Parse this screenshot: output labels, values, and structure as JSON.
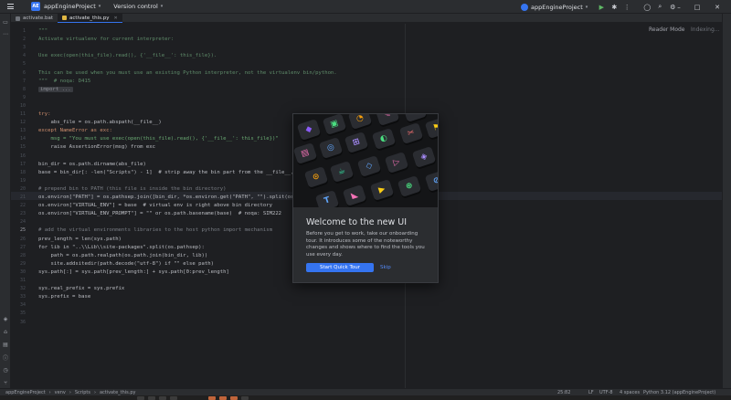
{
  "titlebar": {
    "project_badge": "AE",
    "project_name": "appEngineProject",
    "version_control": "Version control",
    "run_config": "appEngineProject"
  },
  "tabs": [
    {
      "label": "activate.bat"
    },
    {
      "label": "activate_this.py"
    }
  ],
  "editor": {
    "reader_mode": "Reader Mode",
    "indexing": "Indexing...",
    "line_numbers": [
      "1",
      "2",
      "3",
      "4",
      "5",
      "6",
      "7",
      "8",
      "9",
      "10",
      "11",
      "12",
      "13",
      "14",
      "15",
      "16",
      "17",
      "18",
      "19",
      "20",
      "21",
      "22",
      "23",
      "24",
      "25",
      "26",
      "27",
      "28",
      "29",
      "30",
      "31",
      "32",
      "33",
      "34",
      "35",
      "36"
    ],
    "current_line": "25",
    "code": [
      {
        "text": "\"\"\"",
        "cls": "doc"
      },
      {
        "text": "Activate virtualenv for current interpreter:",
        "cls": "doc"
      },
      {
        "text": "",
        "cls": ""
      },
      {
        "text": "Use exec(open(this_file).read(), {'__file__': this_file}).",
        "cls": "doc"
      },
      {
        "text": "",
        "cls": ""
      },
      {
        "text": "This can be used when you must use an existing Python interpreter, not the virtualenv bin/python.",
        "cls": "doc"
      },
      {
        "text": "\"\"\"  # noqa: D415",
        "cls": "doc"
      },
      {
        "text": "import ...",
        "cls": "fold"
      },
      {
        "text": "",
        "cls": ""
      },
      {
        "text": "",
        "cls": ""
      },
      {
        "text": "try:",
        "cls": "kw"
      },
      {
        "text": "    abs_file = os.path.abspath(__file__)",
        "cls": ""
      },
      {
        "text": "except NameError as exc:",
        "cls": "kw"
      },
      {
        "text": "    msg = \"You must use exec(open(this_file).read(), {'__file__': this_file})\"",
        "cls": "str"
      },
      {
        "text": "    raise AssertionError(msg) from exc",
        "cls": ""
      },
      {
        "text": "",
        "cls": ""
      },
      {
        "text": "bin_dir = os.path.dirname(abs_file)",
        "cls": ""
      },
      {
        "text": "base = bin_dir[: -len(\"Scripts\") - 1]  # strip away the bin part from the __file__, plus the path separator",
        "cls": ""
      },
      {
        "text": "",
        "cls": ""
      },
      {
        "text": "# prepend bin to PATH (this file is inside the bin directory)",
        "cls": "cmt"
      },
      {
        "text": "os.environ[\"PATH\"] = os.pathsep.join([bin_dir, *os.environ.get(\"PATH\", \"\").split(os.pathsep)])",
        "cls": ""
      },
      {
        "text": "os.environ[\"VIRTUAL_ENV\"] = base  # virtual env is right above bin directory",
        "cls": ""
      },
      {
        "text": "os.environ[\"VIRTUAL_ENV_PROMPT\"] = \"\" or os.path.basename(base)  # noqa: SIM222",
        "cls": ""
      },
      {
        "text": "",
        "cls": ""
      },
      {
        "text": "# add the virtual environments libraries to the host python import mechanism",
        "cls": "cmt"
      },
      {
        "text": "prev_length = len(sys.path)",
        "cls": ""
      },
      {
        "text": "for lib in \"..\\\\Lib\\\\site-packages\".split(os.pathsep):",
        "cls": ""
      },
      {
        "text": "    path = os.path.realpath(os.path.join(bin_dir, lib))",
        "cls": ""
      },
      {
        "text": "    site.addsitedir(path.decode(\"utf-8\") if \"\" else path)",
        "cls": ""
      },
      {
        "text": "sys.path[:] = sys.path[prev_length:] + sys.path[0:prev_length]",
        "cls": ""
      },
      {
        "text": "",
        "cls": ""
      },
      {
        "text": "sys.real_prefix = sys.prefix",
        "cls": ""
      },
      {
        "text": "sys.prefix = base",
        "cls": ""
      },
      {
        "text": "",
        "cls": ""
      }
    ]
  },
  "popup": {
    "title": "Welcome to the new UI",
    "body": "Before you get to work, take our onboarding tour. It introduces some of the noteworthy changes and shows where to find the tools you use every day.",
    "primary_button": "Start Quick Tour",
    "skip_button": "Skip"
  },
  "statusbar": {
    "breadcrumbs": [
      "appEngineProject",
      "venv",
      "Scripts",
      "activate_this.py"
    ],
    "position": "25:82",
    "line_sep": "LF",
    "encoding": "UTF-8",
    "indent": "4 spaces",
    "interpreter": "Python 3.12 (appEngineProject)"
  },
  "colors": {
    "accent": "#3574f0",
    "editor_bg": "#1e1f22",
    "panel_bg": "#2b2d30"
  }
}
